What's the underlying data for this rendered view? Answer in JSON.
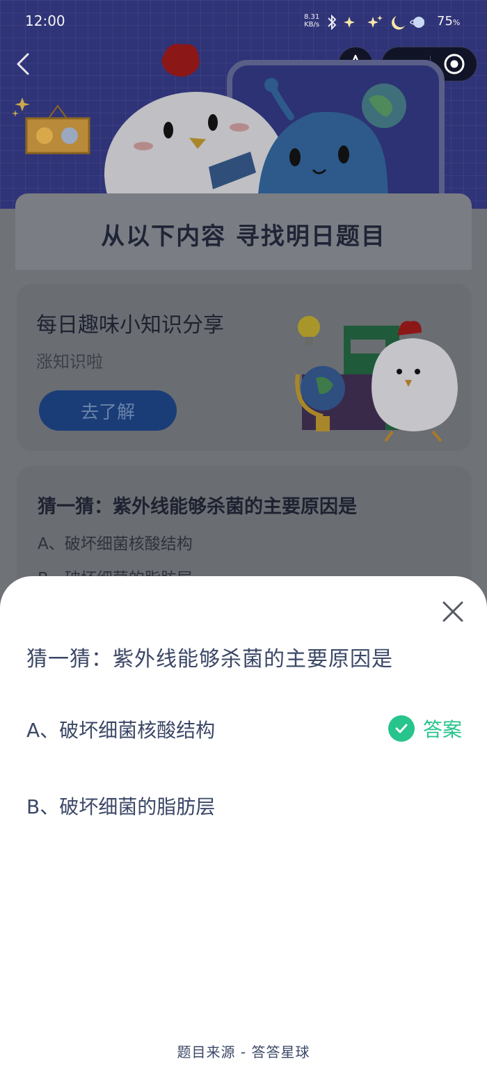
{
  "status_bar": {
    "time": "12:00",
    "net_speed_value": "8.31",
    "net_speed_unit": "KB/s",
    "battery": "75",
    "battery_unit": "%"
  },
  "nav": {
    "back_icon": "chevron-left-icon",
    "star_icon": "star-icon",
    "more_icon": "more-dots-icon",
    "close_icon": "target-close-icon"
  },
  "banner": {
    "title": "从以下内容  寻找明日题目"
  },
  "knowledge_card": {
    "title": "每日趣味小知识分享",
    "subtitle": "涨知识啦",
    "button_label": "去了解"
  },
  "quiz_card": {
    "question": "猜一猜：紫外线能够杀菌的主要原因是",
    "option_a": "A、破坏细菌核酸结构",
    "option_b": "B、破坏细菌的脂肪层"
  },
  "sheet": {
    "question": "猜一猜：紫外线能够杀菌的主要原因是",
    "options": [
      {
        "text": "A、破坏细菌核酸结构",
        "is_answer": true
      },
      {
        "text": "B、破坏细菌的脂肪层",
        "is_answer": false
      }
    ],
    "answer_label": "答案",
    "footer": "题目来源 - 答答星球"
  },
  "colors": {
    "accent_green": "#27c48c",
    "text_primary": "#3b4766",
    "button_blue": "#1a3d78"
  }
}
